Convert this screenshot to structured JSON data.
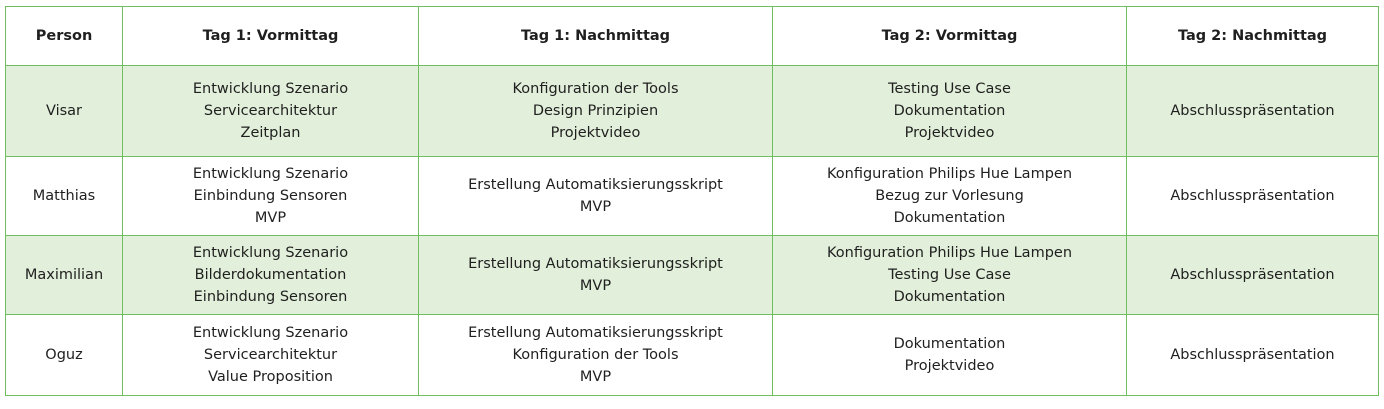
{
  "table": {
    "headers": [
      "Person",
      "Tag 1: Vormittag",
      "Tag 1: Nachmittag",
      "Tag 2: Vormittag",
      "Tag 2: Nachmittag"
    ],
    "rows": [
      {
        "person": "Visar",
        "day1_morning": [
          "Entwicklung Szenario",
          "Servicearchitektur",
          "Zeitplan"
        ],
        "day1_afternoon": [
          "Konfiguration der Tools",
          "Design Prinzipien",
          "Projektvideo"
        ],
        "day2_morning": [
          "Testing Use Case",
          "Dokumentation",
          "Projektvideo"
        ],
        "day2_afternoon": [
          "Abschlusspräsentation"
        ]
      },
      {
        "person": "Matthias",
        "day1_morning": [
          "Entwicklung Szenario",
          "Einbindung Sensoren",
          "MVP"
        ],
        "day1_afternoon": [
          "Erstellung Automatiksierungsskript",
          "MVP"
        ],
        "day2_morning": [
          "Konfiguration Philips Hue Lampen",
          "Bezug zur Vorlesung",
          "Dokumentation"
        ],
        "day2_afternoon": [
          "Abschlusspräsentation"
        ]
      },
      {
        "person": "Maximilian",
        "day1_morning": [
          "Entwicklung Szenario",
          "Bilderdokumentation",
          "Einbindung Sensoren"
        ],
        "day1_afternoon": [
          "Erstellung Automatiksierungsskript",
          "MVP"
        ],
        "day2_morning": [
          "Konfiguration Philips Hue Lampen",
          "Testing Use Case",
          "Dokumentation"
        ],
        "day2_afternoon": [
          "Abschlusspräsentation"
        ]
      },
      {
        "person": "Oguz",
        "day1_morning": [
          "Entwicklung Szenario",
          "Servicearchitektur",
          "Value Proposition"
        ],
        "day1_afternoon": [
          "Erstellung Automatiksierungsskript",
          "Konfiguration der Tools",
          "MVP"
        ],
        "day2_morning": [
          "Dokumentation",
          "Projektvideo"
        ],
        "day2_afternoon": [
          "Abschlusspräsentation"
        ]
      }
    ]
  },
  "colors": {
    "border": "#6fbf60",
    "row_shade": "#e2efda"
  }
}
